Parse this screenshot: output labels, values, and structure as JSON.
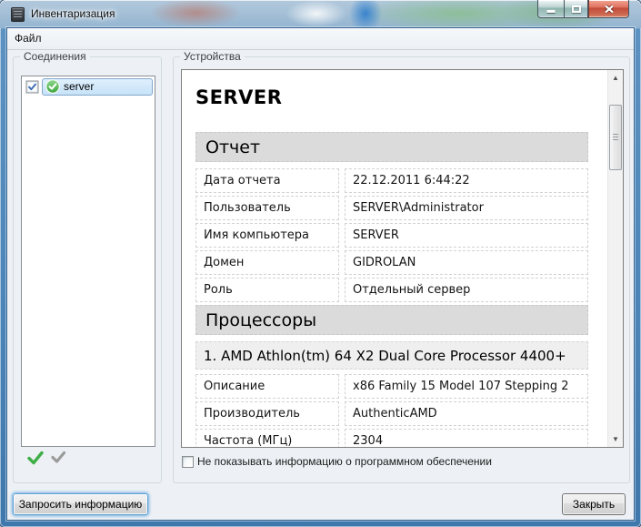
{
  "window": {
    "title": "Инвентаризация"
  },
  "menu": {
    "items": [
      {
        "label": "Файл"
      }
    ]
  },
  "icons": {
    "app": "chip-icon",
    "minimize": "minimize-bar",
    "maximize": "restore-square",
    "close": "cross",
    "connection_status": "green-check-circle",
    "check_all": "green-check",
    "uncheck_all": "gray-check",
    "scroll_up": "▲",
    "scroll_down": "▼"
  },
  "colors": {
    "titlebar_blue": "#93b4d0",
    "selection_border": "#84a7cb",
    "selection_fill": "#c7e2f8",
    "status_green": "#3da53d",
    "close_red": "#c14a37",
    "section_header_bg": "#dbdbdb",
    "subsection_bg": "#efefef"
  },
  "connections": {
    "group_label": "Соединения",
    "items": [
      {
        "label": "server",
        "checked": true,
        "status": "online",
        "selected": true
      }
    ]
  },
  "devices": {
    "group_label": "Устройства",
    "report": {
      "title": "SERVER",
      "sections": [
        {
          "heading": "Отчет",
          "rows": [
            [
              "Дата отчета",
              "22.12.2011 6:44:22"
            ],
            [
              "Пользователь",
              "SERVER\\Administrator"
            ],
            [
              "Имя компьютера",
              "SERVER"
            ],
            [
              "Домен",
              "GIDROLAN"
            ],
            [
              "Роль",
              "Отдельный сервер"
            ]
          ]
        },
        {
          "heading": "Процессоры",
          "subheading": "1. AMD Athlon(tm) 64 X2 Dual Core Processor 4400+",
          "rows": [
            [
              "Описание",
              "x86 Family 15 Model 107 Stepping 2"
            ],
            [
              "Производитель",
              "AuthenticAMD"
            ],
            [
              "Частота (МГц)",
              "2304"
            ]
          ]
        }
      ]
    },
    "hide_software_checkbox": {
      "label": "Не показывать информацию о программном обеспечении",
      "checked": false
    }
  },
  "footer": {
    "request_button": "Запросить информацию",
    "close_button": "Закрыть"
  }
}
